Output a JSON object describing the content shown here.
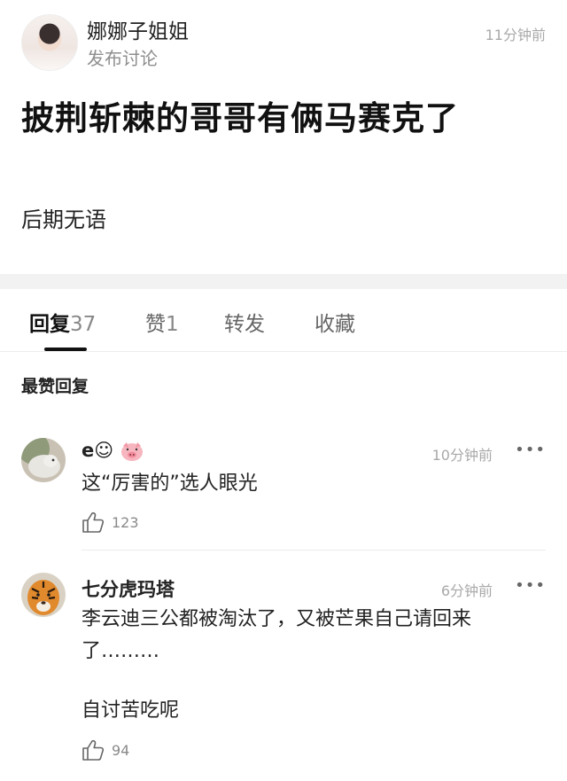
{
  "post": {
    "author": "娜娜子姐姐",
    "kind": "发布讨论",
    "time": "11分钟前",
    "title": "披荆斩棘的哥哥有俩马赛克了",
    "body": "后期无语"
  },
  "tabs": [
    {
      "label": "回复",
      "count": "37"
    },
    {
      "label": "赞",
      "count": "1"
    },
    {
      "label": "转发",
      "count": ""
    },
    {
      "label": "收藏",
      "count": ""
    }
  ],
  "section": {
    "title": "最赞回复"
  },
  "comments": [
    {
      "name": "e☺",
      "name_emoji": "pig-face",
      "time": "10分钟前",
      "text": "这“厉害的”选人眼光",
      "likes": "123"
    },
    {
      "name": "七分虎玛塔",
      "time": "6分钟前",
      "text": "李云迪三公都被淘汰了，又被芒果自己请回来了………",
      "text2": "自讨苦吃呢",
      "likes": "94"
    }
  ],
  "more_label": "•••",
  "icons": {
    "like": "thumbs-up-icon",
    "more": "more-dots-icon"
  },
  "colors": {
    "text": "#111111",
    "muted": "#8e8e8e",
    "band": "#f2f2f2",
    "divider": "#ececec"
  }
}
